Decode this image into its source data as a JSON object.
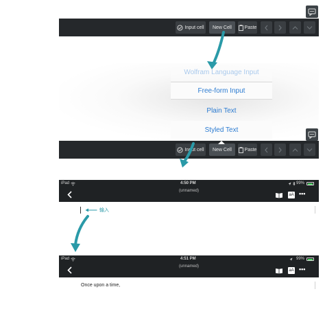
{
  "toolbar": {
    "input_cell_label": "Input cell",
    "new_cell_label": "New Cell",
    "paste_label": "Paste"
  },
  "menu": {
    "items": [
      "Wolfram Language Input",
      "Free-form Input",
      "Plain Text",
      "Styled Text"
    ]
  },
  "screen1": {
    "carrier": "iPad",
    "time": "4:50 PM",
    "battery": "99%",
    "doc_title": "(unnamed)",
    "annotation": "输入"
  },
  "screen2": {
    "carrier": "iPad",
    "time": "4:51 PM",
    "battery": "99%",
    "doc_title": "(unnamed)",
    "body_text": "Once upon a time,"
  },
  "header": {
    "font_button_label": "aA",
    "more_label": "•••"
  },
  "colors": {
    "toolbar_bg": "#25282b",
    "accent_blue": "#2b7bd1",
    "arrow_teal": "#2a9aa8",
    "battery_green": "#4cd964"
  }
}
